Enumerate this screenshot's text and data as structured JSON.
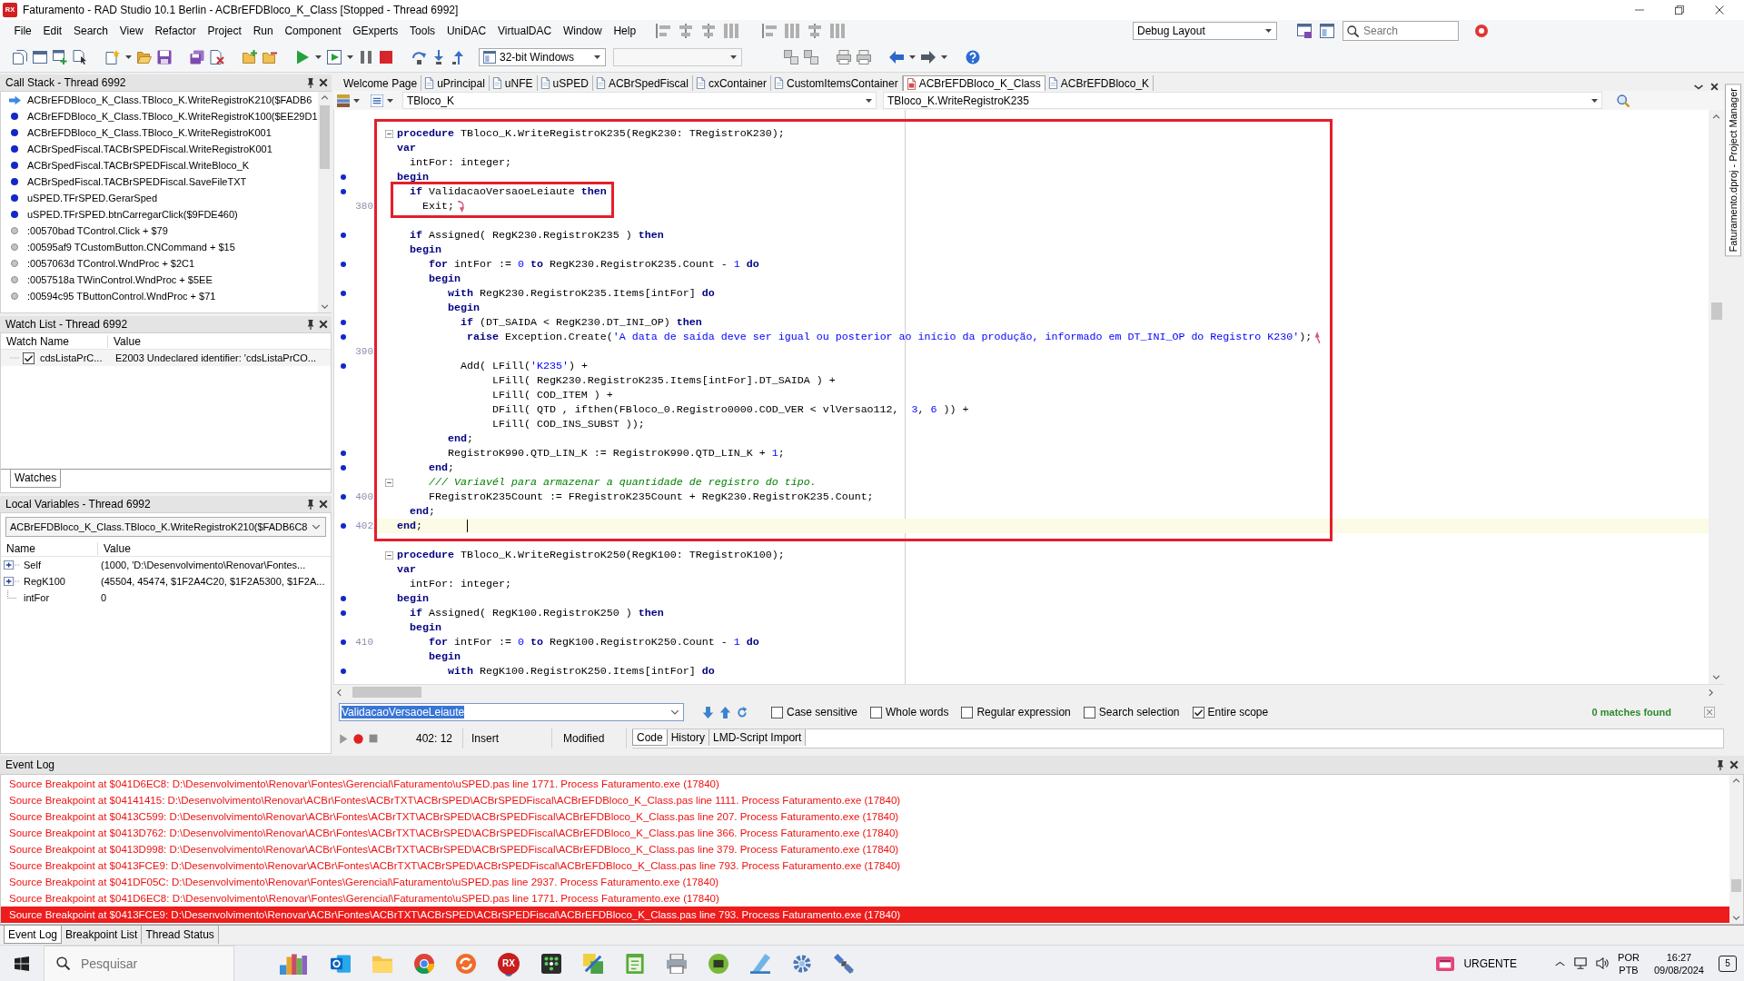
{
  "window": {
    "icon_text": "RX",
    "title": "Faturamento - RAD Studio 10.1 Berlin - ACBrEFDBloco_K_Class [Stopped - Thread 6992]"
  },
  "menu": [
    "File",
    "Edit",
    "Search",
    "View",
    "Refactor",
    "Project",
    "Run",
    "Component",
    "GExperts",
    "Tools",
    "UniDAC",
    "VirtualDAC",
    "Window",
    "Help"
  ],
  "layout_combo": {
    "value": "Debug Layout"
  },
  "search": {
    "placeholder": "Search"
  },
  "platform_combo": {
    "value": "32-bit Windows"
  },
  "call_stack": {
    "title": "Call Stack - Thread 6992",
    "frames": [
      {
        "kind": "current",
        "text": "ACBrEFDBloco_K_Class.TBloco_K.WriteRegistroK210($FADB6"
      },
      {
        "kind": "source",
        "text": "ACBrEFDBloco_K_Class.TBloco_K.WriteRegistroK100($EE29D1"
      },
      {
        "kind": "source",
        "text": "ACBrEFDBloco_K_Class.TBloco_K.WriteRegistroK001"
      },
      {
        "kind": "source",
        "text": "ACBrSpedFiscal.TACBrSPEDFiscal.WriteRegistroK001"
      },
      {
        "kind": "source",
        "text": "ACBrSpedFiscal.TACBrSPEDFiscal.WriteBloco_K"
      },
      {
        "kind": "source",
        "text": "ACBrSpedFiscal.TACBrSPEDFiscal.SaveFileTXT"
      },
      {
        "kind": "source",
        "text": "uSPED.TFrSPED.GerarSped"
      },
      {
        "kind": "source",
        "text": "uSPED.TFrSPED.btnCarregarClick($9FDE460)"
      },
      {
        "kind": "address",
        "text": ":00570bad TControl.Click + $79"
      },
      {
        "kind": "address",
        "text": ":00595af9 TCustomButton.CNCommand + $15"
      },
      {
        "kind": "address",
        "text": ":0057063d TControl.WndProc + $2C1"
      },
      {
        "kind": "address",
        "text": ":0057518a TWinControl.WndProc + $5EE"
      },
      {
        "kind": "address",
        "text": ":00594c95 TButtonControl.WndProc + $71"
      }
    ]
  },
  "watch_list": {
    "title": "Watch List - Thread 6992",
    "columns": [
      "Watch Name",
      "Value"
    ],
    "rows": [
      {
        "checked": true,
        "name": "cdsListaPrC...",
        "value": "E2003 Undeclared identifier: 'cdsListaPrCO..."
      }
    ],
    "tabs": [
      {
        "label": "Watches",
        "selected": true
      }
    ]
  },
  "local_variables": {
    "title": "Local Variables - Thread 6992",
    "frame_combo": {
      "value": "ACBrEFDBloco_K_Class.TBloco_K.WriteRegistroK210($FADB6C8"
    },
    "columns": [
      "Name",
      "Value"
    ],
    "rows": [
      {
        "kind": "collapsed",
        "name": "Self",
        "value": "(1000, 'D:\\Desenvolvimento\\Renovar\\Fontes..."
      },
      {
        "kind": "collapsed",
        "name": "RegK100",
        "value": "(45504, 45474, $1F2A4C20, $1F2A5300, $1F2A..."
      },
      {
        "kind": "leaf",
        "name": "intFor",
        "value": "0"
      }
    ]
  },
  "editor": {
    "tabs": [
      {
        "kind": "welcome",
        "label": "Welcome Page",
        "selected": false
      },
      {
        "kind": "unit",
        "label": "uPrincipal",
        "selected": false
      },
      {
        "kind": "unit",
        "label": "uNFE",
        "selected": false
      },
      {
        "kind": "unit",
        "label": "uSPED",
        "selected": false
      },
      {
        "kind": "unit",
        "label": "ACBrSpedFiscal",
        "selected": false
      },
      {
        "kind": "unit",
        "label": "cxContainer",
        "selected": false
      },
      {
        "kind": "unit",
        "label": "CustomItemsContainer",
        "selected": false
      },
      {
        "kind": "unit",
        "label": "ACBrEFDBloco_K_Class",
        "selected": true
      },
      {
        "kind": "unit",
        "label": "ACBrEFDBloco_K",
        "selected": false
      }
    ],
    "class_combo": {
      "value": "TBloco_K"
    },
    "method_combo": {
      "value": "TBloco_K.WriteRegistroK235"
    },
    "code": {
      "sections": [
        {
          "framed": true,
          "groups": [
            {
              "framed": false,
              "lines": [
                {
                  "dot": false,
                  "fold": true,
                  "current": false,
                  "tokens": [
                    {
                      "kind": "keyword",
                      "text": "procedure"
                    },
                    {
                      "kind": "plain",
                      "text": " TBloco_K.WriteRegistroK235(RegK230: TRegistroK230);"
                    }
                  ]
                },
                {
                  "dot": false,
                  "fold": false,
                  "current": false,
                  "tokens": [
                    {
                      "kind": "keyword",
                      "text": "var"
                    }
                  ]
                },
                {
                  "dot": false,
                  "fold": false,
                  "current": false,
                  "tokens": [
                    {
                      "kind": "plain",
                      "text": "  intFor: integer;"
                    }
                  ]
                },
                {
                  "dot": true,
                  "fold": false,
                  "current": false,
                  "tokens": [
                    {
                      "kind": "keyword",
                      "text": "begin"
                    }
                  ]
                }
              ]
            },
            {
              "framed": true,
              "lines": [
                {
                  "dot": true,
                  "fold": false,
                  "current": false,
                  "tokens": [
                    {
                      "kind": "keyword",
                      "text": "  if"
                    },
                    {
                      "kind": "plain",
                      "text": " ValidacaoVersaoeLeiaute "
                    },
                    {
                      "kind": "keyword",
                      "text": "then"
                    }
                  ]
                },
                {
                  "dot": false,
                  "fold": false,
                  "current": false,
                  "number": "380",
                  "tokens": [
                    {
                      "kind": "plain",
                      "text": "    Exit;"
                    },
                    {
                      "kind": "exit-mark"
                    }
                  ]
                }
              ]
            },
            {
              "framed": false,
              "lines": [
                {
                  "dot": false,
                  "fold": false,
                  "current": false
                },
                {
                  "dot": true,
                  "fold": false,
                  "current": false,
                  "tokens": [
                    {
                      "kind": "keyword",
                      "text": "  if"
                    },
                    {
                      "kind": "plain",
                      "text": " Assigned( RegK230.RegistroK235 ) "
                    },
                    {
                      "kind": "keyword",
                      "text": "then"
                    }
                  ]
                },
                {
                  "dot": false,
                  "fold": false,
                  "current": false,
                  "tokens": [
                    {
                      "kind": "keyword",
                      "text": "  begin"
                    }
                  ]
                },
                {
                  "dot": true,
                  "fold": false,
                  "current": false,
                  "tokens": [
                    {
                      "kind": "keyword",
                      "text": "     for"
                    },
                    {
                      "kind": "plain",
                      "text": " intFor := "
                    },
                    {
                      "kind": "number",
                      "text": "0"
                    },
                    {
                      "kind": "keyword",
                      "text": " to"
                    },
                    {
                      "kind": "plain",
                      "text": " RegK230.RegistroK235.Count - "
                    },
                    {
                      "kind": "number",
                      "text": "1"
                    },
                    {
                      "kind": "keyword",
                      "text": " do"
                    }
                  ]
                },
                {
                  "dot": false,
                  "fold": false,
                  "current": false,
                  "tokens": [
                    {
                      "kind": "keyword",
                      "text": "     begin"
                    }
                  ]
                },
                {
                  "dot": true,
                  "fold": false,
                  "current": false,
                  "tokens": [
                    {
                      "kind": "keyword",
                      "text": "        with"
                    },
                    {
                      "kind": "plain",
                      "text": " RegK230.RegistroK235.Items[intFor] "
                    },
                    {
                      "kind": "keyword",
                      "text": "do"
                    }
                  ]
                },
                {
                  "dot": false,
                  "fold": false,
                  "current": false,
                  "tokens": [
                    {
                      "kind": "keyword",
                      "text": "        begin"
                    }
                  ]
                },
                {
                  "dot": true,
                  "fold": false,
                  "current": false,
                  "tokens": [
                    {
                      "kind": "keyword",
                      "text": "          if"
                    },
                    {
                      "kind": "plain",
                      "text": " (DT_SAIDA < RegK230.DT_INI_OP) "
                    },
                    {
                      "kind": "keyword",
                      "text": "then"
                    }
                  ]
                },
                {
                  "dot": true,
                  "fold": false,
                  "current": false,
                  "tokens": [
                    {
                      "kind": "keyword",
                      "text": "           raise"
                    },
                    {
                      "kind": "plain",
                      "text": " Exception.Create("
                    },
                    {
                      "kind": "string",
                      "text": "'A data de saída deve ser igual ou posterior ao início da produção, informado em DT_INI_OP do Registro K230'"
                    },
                    {
                      "kind": "plain",
                      "text": ");"
                    },
                    {
                      "kind": "raise-mark"
                    }
                  ]
                },
                {
                  "dot": false,
                  "fold": false,
                  "current": false,
                  "number": "390"
                },
                {
                  "dot": true,
                  "fold": false,
                  "current": false,
                  "tokens": [
                    {
                      "kind": "plain",
                      "text": "          Add( LFill("
                    },
                    {
                      "kind": "string",
                      "text": "'K235'"
                    },
                    {
                      "kind": "plain",
                      "text": ") +"
                    }
                  ]
                },
                {
                  "dot": false,
                  "fold": false,
                  "current": false,
                  "tokens": [
                    {
                      "kind": "plain",
                      "text": "               LFill( RegK230.RegistroK235.Items[intFor].DT_SAIDA ) +"
                    }
                  ]
                },
                {
                  "dot": false,
                  "fold": false,
                  "current": false,
                  "tokens": [
                    {
                      "kind": "plain",
                      "text": "               LFill( COD_ITEM ) +"
                    }
                  ]
                },
                {
                  "dot": false,
                  "fold": false,
                  "current": false,
                  "tokens": [
                    {
                      "kind": "plain",
                      "text": "               DFill( QTD , ifthen(FBloco_0.Registro0000.COD_VER < vlVersao112,  "
                    },
                    {
                      "kind": "number",
                      "text": "3"
                    },
                    {
                      "kind": "plain",
                      "text": ", "
                    },
                    {
                      "kind": "number",
                      "text": "6"
                    },
                    {
                      "kind": "plain",
                      "text": " )) +"
                    }
                  ]
                },
                {
                  "dot": false,
                  "fold": false,
                  "current": false,
                  "tokens": [
                    {
                      "kind": "plain",
                      "text": "               LFill( COD_INS_SUBST ));"
                    }
                  ]
                },
                {
                  "dot": false,
                  "fold": false,
                  "current": false,
                  "tokens": [
                    {
                      "kind": "keyword",
                      "text": "        end"
                    },
                    {
                      "kind": "plain",
                      "text": ";"
                    }
                  ]
                },
                {
                  "dot": true,
                  "fold": false,
                  "current": false,
                  "tokens": [
                    {
                      "kind": "plain",
                      "text": "        RegistroK990.QTD_LIN_K := RegistroK990.QTD_LIN_K + "
                    },
                    {
                      "kind": "number",
                      "text": "1"
                    },
                    {
                      "kind": "plain",
                      "text": ";"
                    }
                  ]
                },
                {
                  "dot": true,
                  "fold": false,
                  "current": false,
                  "tokens": [
                    {
                      "kind": "keyword",
                      "text": "     end"
                    },
                    {
                      "kind": "plain",
                      "text": ";"
                    }
                  ]
                },
                {
                  "dot": false,
                  "fold": true,
                  "current": false,
                  "tokens": [
                    {
                      "kind": "comment",
                      "text": "     /// Variavél para armazenar a quantidade de registro do tipo."
                    }
                  ]
                },
                {
                  "dot": true,
                  "fold": false,
                  "current": false,
                  "number": "400",
                  "tokens": [
                    {
                      "kind": "plain",
                      "text": "     FRegistroK235Count := FRegistroK235Count + RegK230.RegistroK235.Count;"
                    }
                  ]
                },
                {
                  "dot": false,
                  "fold": false,
                  "current": false,
                  "tokens": [
                    {
                      "kind": "keyword",
                      "text": "  end"
                    },
                    {
                      "kind": "plain",
                      "text": ";"
                    }
                  ]
                },
                {
                  "dot": true,
                  "fold": false,
                  "current": true,
                  "number": "402",
                  "tokens": [
                    {
                      "kind": "keyword",
                      "text": "end"
                    },
                    {
                      "kind": "plain",
                      "text": ";"
                    },
                    {
                      "kind": "caret"
                    }
                  ]
                }
              ]
            }
          ]
        },
        {
          "framed": false,
          "groups": [
            {
              "framed": false,
              "lines": [
                {
                  "dot": false,
                  "fold": false,
                  "current": false
                },
                {
                  "dot": false,
                  "fold": true,
                  "current": false,
                  "tokens": [
                    {
                      "kind": "keyword",
                      "text": "procedure"
                    },
                    {
                      "kind": "plain",
                      "text": " TBloco_K.WriteRegistroK250(RegK100: TRegistroK100);"
                    }
                  ]
                },
                {
                  "dot": false,
                  "fold": false,
                  "current": false,
                  "tokens": [
                    {
                      "kind": "keyword",
                      "text": "var"
                    }
                  ]
                },
                {
                  "dot": false,
                  "fold": false,
                  "current": false,
                  "tokens": [
                    {
                      "kind": "plain",
                      "text": "  intFor: integer;"
                    }
                  ]
                },
                {
                  "dot": true,
                  "fold": false,
                  "current": false,
                  "tokens": [
                    {
                      "kind": "keyword",
                      "text": "begin"
                    }
                  ]
                },
                {
                  "dot": true,
                  "fold": false,
                  "current": false,
                  "tokens": [
                    {
                      "kind": "keyword",
                      "text": "  if"
                    },
                    {
                      "kind": "plain",
                      "text": " Assigned( RegK100.RegistroK250 ) "
                    },
                    {
                      "kind": "keyword",
                      "text": "then"
                    }
                  ]
                },
                {
                  "dot": false,
                  "fold": false,
                  "current": false,
                  "tokens": [
                    {
                      "kind": "keyword",
                      "text": "  begin"
                    }
                  ]
                },
                {
                  "dot": true,
                  "fold": false,
                  "current": false,
                  "number": "410",
                  "tokens": [
                    {
                      "kind": "keyword",
                      "text": "     for"
                    },
                    {
                      "kind": "plain",
                      "text": " intFor := "
                    },
                    {
                      "kind": "number",
                      "text": "0"
                    },
                    {
                      "kind": "keyword",
                      "text": " to"
                    },
                    {
                      "kind": "plain",
                      "text": " RegK100.RegistroK250.Count - "
                    },
                    {
                      "kind": "number",
                      "text": "1"
                    },
                    {
                      "kind": "keyword",
                      "text": " do"
                    }
                  ]
                },
                {
                  "dot": false,
                  "fold": false,
                  "current": false,
                  "tokens": [
                    {
                      "kind": "keyword",
                      "text": "     begin"
                    }
                  ]
                },
                {
                  "dot": true,
                  "fold": false,
                  "current": false,
                  "tokens": [
                    {
                      "kind": "keyword",
                      "text": "        with"
                    },
                    {
                      "kind": "plain",
                      "text": " RegK100.RegistroK250.Items[intFor] "
                    },
                    {
                      "kind": "keyword",
                      "text": "do"
                    }
                  ]
                }
              ]
            }
          ]
        }
      ]
    }
  },
  "find_bar": {
    "value": "ValidacaoVersaoeLeiaute",
    "options": [
      {
        "label": "Case sensitive",
        "checked": false
      },
      {
        "label": "Whole words",
        "checked": false
      },
      {
        "label": "Regular expression",
        "checked": false
      },
      {
        "label": "Search selection",
        "checked": false
      },
      {
        "label": "Entire scope",
        "checked": true
      }
    ],
    "result": "0 matches found"
  },
  "status_bar": {
    "position": "402: 12",
    "mode": "Insert",
    "state": "Modified",
    "tabs": [
      {
        "label": "Code",
        "selected": true
      },
      {
        "label": "History",
        "selected": false
      },
      {
        "label": "LMD-Script Import",
        "selected": false
      }
    ]
  },
  "project_manager_tab": {
    "label": "Faturamento.dproj - Project Manager"
  },
  "event_log": {
    "title": "Event Log",
    "entries": [
      {
        "text": "Source Breakpoint at $041D6EC8: D:\\Desenvolvimento\\Renovar\\Fontes\\Gerencial\\Faturamento\\uSPED.pas line 1771. Process Faturamento.exe (17840)",
        "selected": false
      },
      {
        "text": "Source Breakpoint at $04141415: D:\\Desenvolvimento\\Renovar\\ACBr\\Fontes\\ACBrTXT\\ACBrSPED\\ACBrSPEDFiscal\\ACBrEFDBloco_K_Class.pas line 1111. Process Faturamento.exe (17840)",
        "selected": false
      },
      {
        "text": "Source Breakpoint at $0413C599: D:\\Desenvolvimento\\Renovar\\ACBr\\Fontes\\ACBrTXT\\ACBrSPED\\ACBrSPEDFiscal\\ACBrEFDBloco_K_Class.pas line 207. Process Faturamento.exe (17840)",
        "selected": false
      },
      {
        "text": "Source Breakpoint at $0413D762: D:\\Desenvolvimento\\Renovar\\ACBr\\Fontes\\ACBrTXT\\ACBrSPED\\ACBrSPEDFiscal\\ACBrEFDBloco_K_Class.pas line 366. Process Faturamento.exe (17840)",
        "selected": false
      },
      {
        "text": "Source Breakpoint at $0413D998: D:\\Desenvolvimento\\Renovar\\ACBr\\Fontes\\ACBrTXT\\ACBrSPED\\ACBrSPEDFiscal\\ACBrEFDBloco_K_Class.pas line 379. Process Faturamento.exe (17840)",
        "selected": false
      },
      {
        "text": "Source Breakpoint at $0413FCE9: D:\\Desenvolvimento\\Renovar\\ACBr\\Fontes\\ACBrTXT\\ACBrSPED\\ACBrSPEDFiscal\\ACBrEFDBloco_K_Class.pas line 793. Process Faturamento.exe (17840)",
        "selected": false
      },
      {
        "text": "Source Breakpoint at $041DF05C: D:\\Desenvolvimento\\Renovar\\Fontes\\Gerencial\\Faturamento\\uSPED.pas line 2937. Process Faturamento.exe (17840)",
        "selected": false
      },
      {
        "text": "Source Breakpoint at $041D6EC8: D:\\Desenvolvimento\\Renovar\\Fontes\\Gerencial\\Faturamento\\uSPED.pas line 1771. Process Faturamento.exe (17840)",
        "selected": false
      },
      {
        "text": "Source Breakpoint at $0413FCE9: D:\\Desenvolvimento\\Renovar\\ACBr\\Fontes\\ACBrTXT\\ACBrSPED\\ACBrSPEDFiscal\\ACBrEFDBloco_K_Class.pas line 793. Process Faturamento.exe (17840)",
        "selected": true
      }
    ],
    "tabs": [
      {
        "label": "Event Log",
        "selected": true
      },
      {
        "label": "Breakpoint List",
        "selected": false
      },
      {
        "label": "Thread Status",
        "selected": false
      }
    ]
  },
  "taskbar": {
    "search_placeholder": "Pesquisar",
    "app_icon_text": "RX",
    "alert_label": "URGENTE",
    "language": "POR",
    "keyboard": "PTB",
    "time": "16:27",
    "date": "09/08/2024",
    "notifications": "5"
  }
}
